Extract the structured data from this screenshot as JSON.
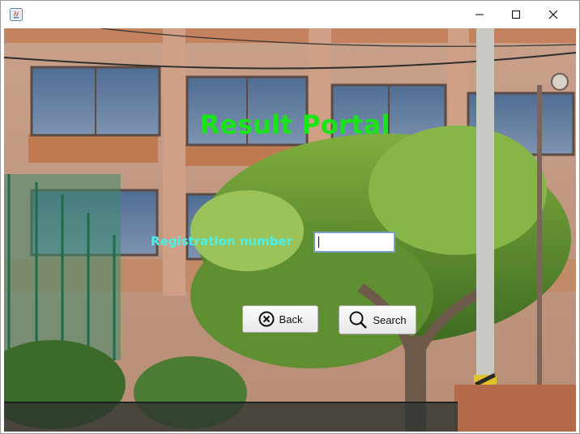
{
  "window": {
    "title": "",
    "controls": {
      "minimize": "minimize-icon",
      "maximize": "maximize-icon",
      "close": "close-icon"
    }
  },
  "header": {
    "title": "Result Portal",
    "title_color": "#18e418"
  },
  "form": {
    "registration_label": "Registration number",
    "label_color": "#4af0ea",
    "registration_value": ""
  },
  "buttons": {
    "back_label": "Back",
    "back_icon": "circle-x-icon",
    "search_label": "Search",
    "search_icon": "magnifier-icon"
  }
}
